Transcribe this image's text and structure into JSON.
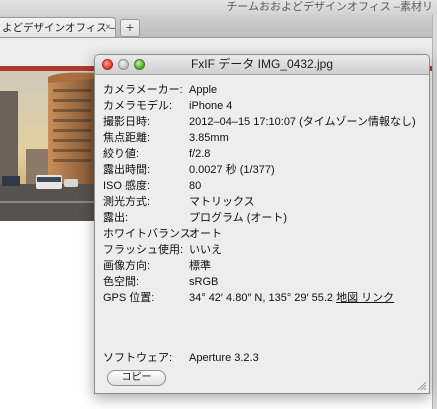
{
  "browser": {
    "window_title": "チームおおよどデザインオフィス –素材リ",
    "tab_label": "よどデザインオフィス –…",
    "tab_close": "×",
    "new_tab": "+"
  },
  "dialog": {
    "title": "FxIF データ IMG_0432.jpg",
    "properties": [
      {
        "label": "カメラメーカー:",
        "value": "Apple"
      },
      {
        "label": "カメラモデル:",
        "value": "iPhone 4"
      },
      {
        "label": "撮影日時:",
        "value": "2012–04–15 17:10:07 (タイムゾーン情報なし)"
      },
      {
        "label": "焦点距離:",
        "value": "3.85mm"
      },
      {
        "label": "絞り値:",
        "value": "f/2.8"
      },
      {
        "label": "露出時間:",
        "value": "0.0027 秒 (1/377)"
      },
      {
        "label": "ISO 感度:",
        "value": "80"
      },
      {
        "label": "測光方式:",
        "value": "マトリックス"
      },
      {
        "label": "露出:",
        "value": "プログラム (オート)"
      },
      {
        "label": "ホワイトバランス:",
        "value": "オート"
      },
      {
        "label": "フラッシュ使用:",
        "value": "いいえ"
      },
      {
        "label": "画像方向:",
        "value": "標準"
      },
      {
        "label": "色空間:",
        "value": "sRGB"
      },
      {
        "label": "GPS 位置:",
        "value": "34° 42′ 4.80″ N, 135° 29′ 55.2"
      }
    ],
    "gps_link": "地図 リンク",
    "software_label": "ソフトウェア:",
    "software_value": "Aperture 3.2.3",
    "copy_button": "コピー"
  },
  "colors": {
    "accent_red": "#b03a2e",
    "close_button": "#d8382c",
    "zoom_button": "#4fa52a"
  }
}
